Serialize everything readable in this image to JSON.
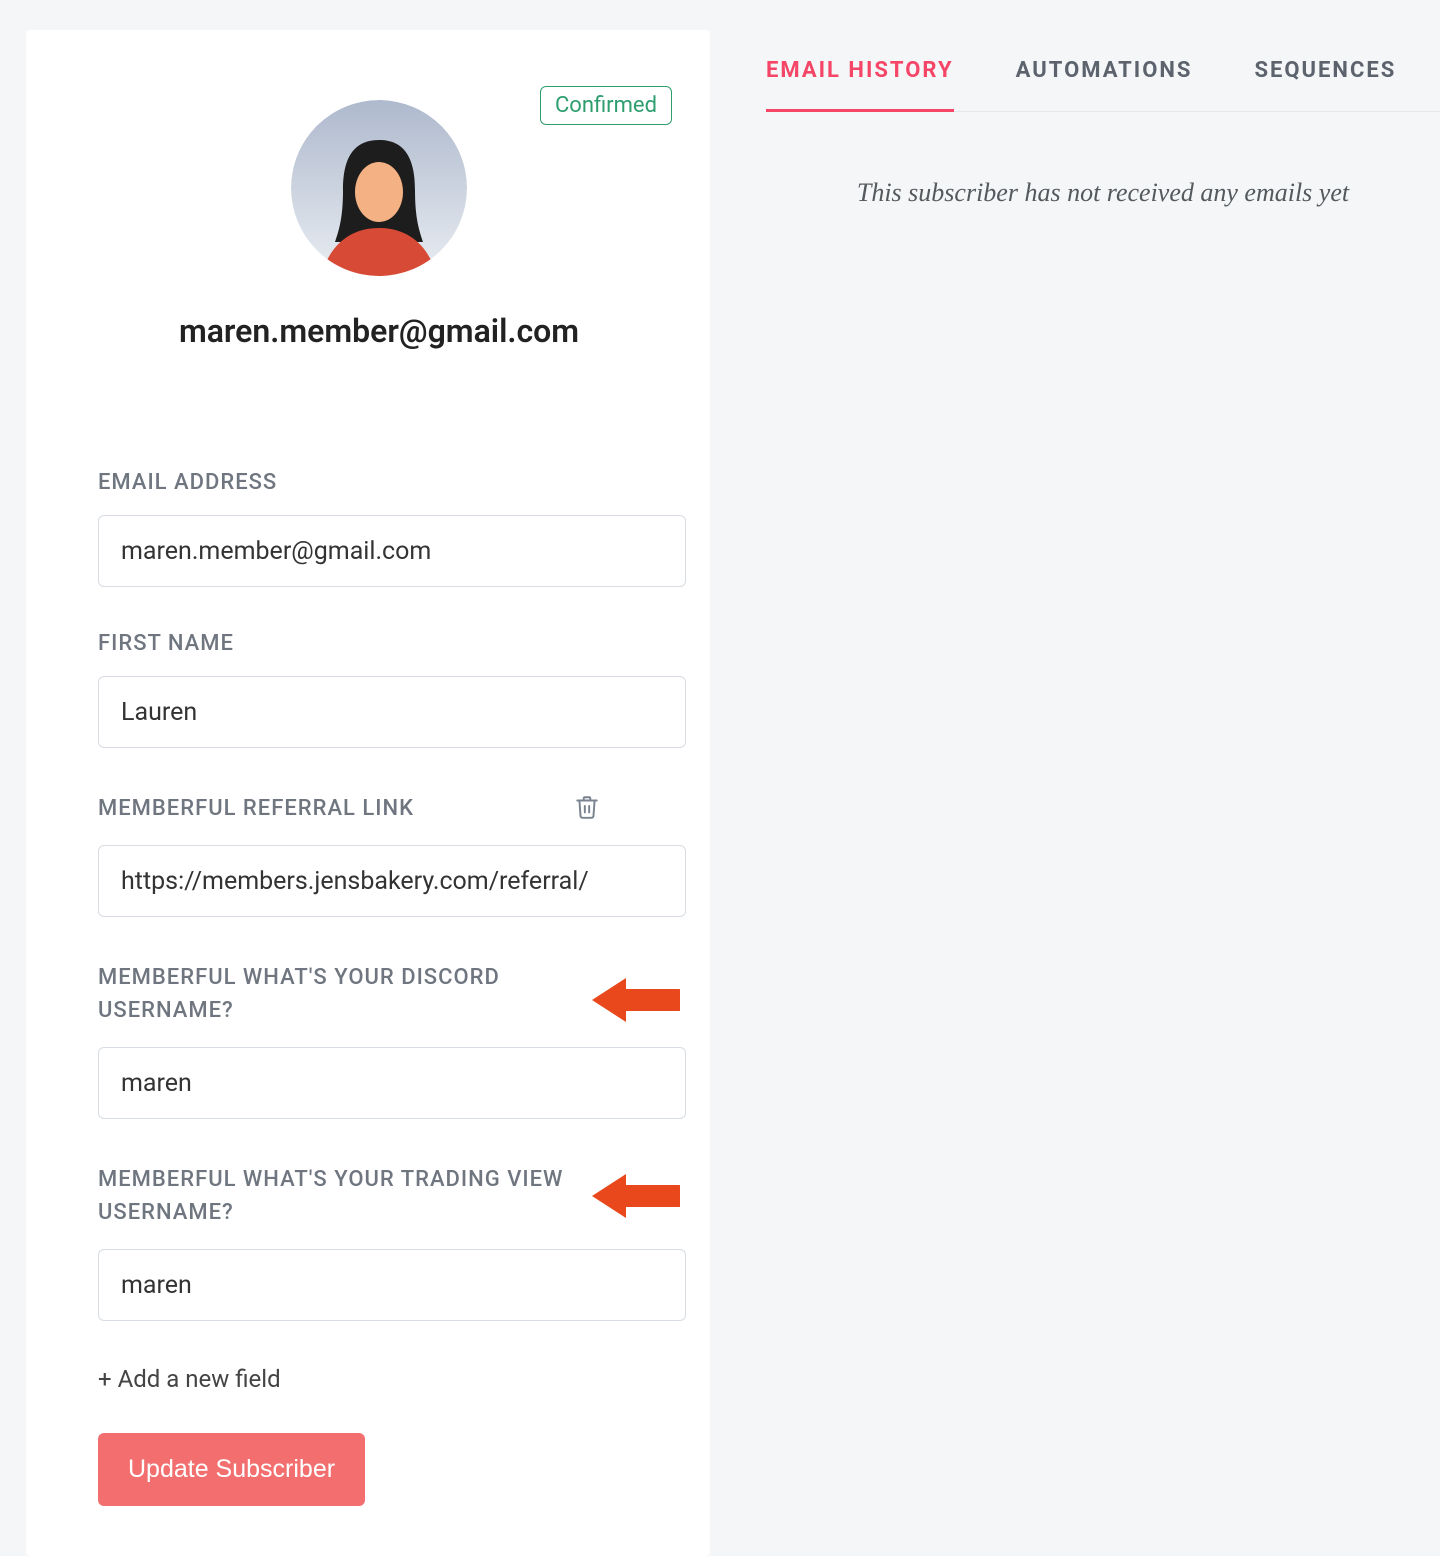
{
  "badge": "Confirmed",
  "subscriber_email": "maren.member@gmail.com",
  "fields": {
    "email_label": "EMAIL ADDRESS",
    "email_value": "maren.member@gmail.com",
    "firstname_label": "FIRST NAME",
    "firstname_value": "Lauren",
    "referral_label": "MEMBERFUL REFERRAL LINK",
    "referral_value": "https://members.jensbakery.com/referral/",
    "discord_label": "MEMBERFUL WHAT'S YOUR DISCORD USERNAME?",
    "discord_value": "maren",
    "tradingview_label": "MEMBERFUL WHAT'S YOUR TRADING VIEW USERNAME?",
    "tradingview_value": "maren"
  },
  "add_field_label": "+ Add a new field",
  "update_button_label": "Update Subscriber",
  "tabs": {
    "email_history": "EMAIL HISTORY",
    "automations": "AUTOMATIONS",
    "sequences": "SEQUENCES"
  },
  "empty_state": "This subscriber has not received any emails yet"
}
